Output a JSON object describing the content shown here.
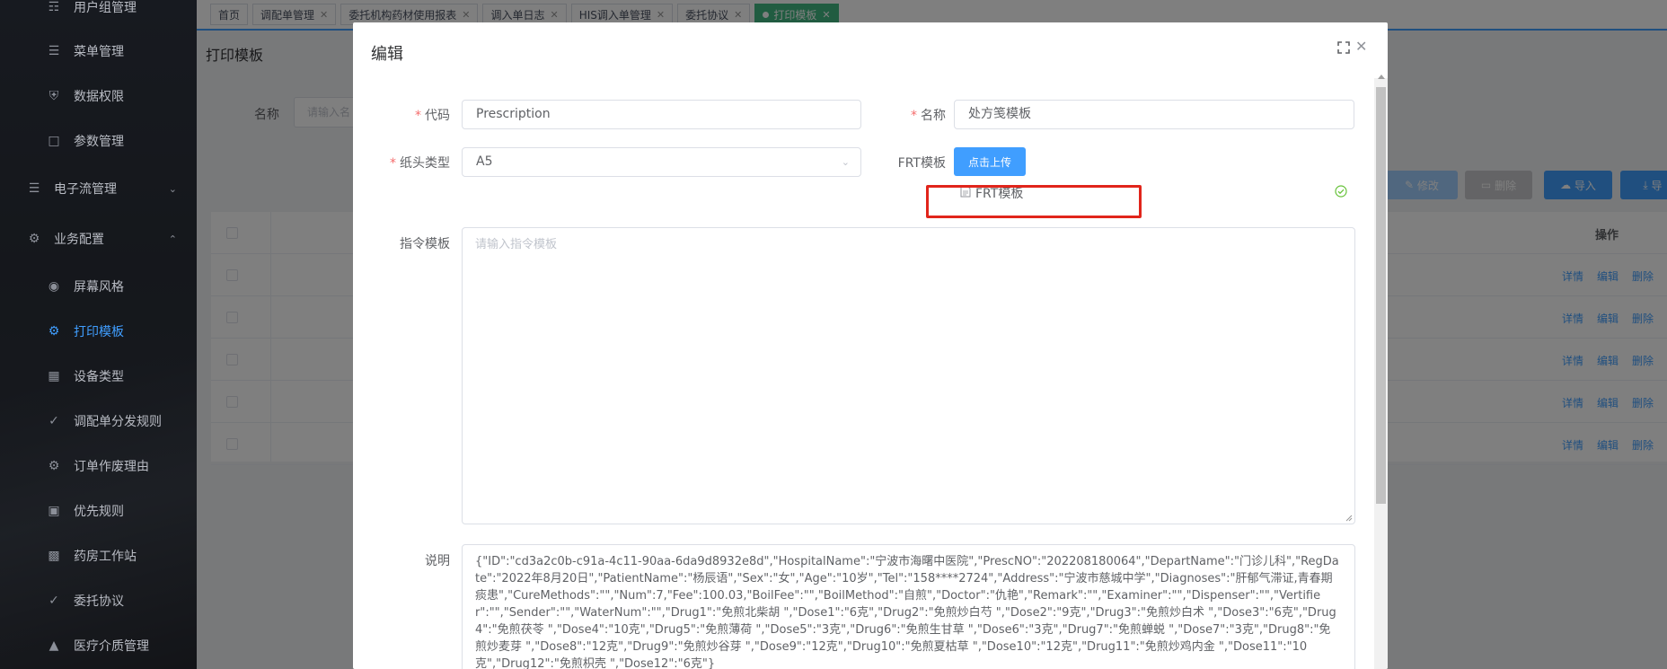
{
  "sidebar": {
    "items": [
      {
        "label": "用户组管理",
        "icon": "sitemap-icon"
      },
      {
        "label": "菜单管理",
        "icon": "menu-icon"
      },
      {
        "label": "数据权限",
        "icon": "shield-icon"
      },
      {
        "label": "参数管理",
        "icon": "document-icon"
      },
      {
        "label": "电子流管理",
        "icon": "sliders-icon"
      },
      {
        "label": "业务配置",
        "icon": "gear-icon"
      },
      {
        "label": "屏幕风格",
        "icon": "palette-icon"
      },
      {
        "label": "打印模板",
        "icon": "gear-icon"
      },
      {
        "label": "设备类型",
        "icon": "grid-icon"
      },
      {
        "label": "调配单分发规则",
        "icon": "rule-icon"
      },
      {
        "label": "订单作废理由",
        "icon": "gear-icon"
      },
      {
        "label": "优先规则",
        "icon": "robot-icon"
      },
      {
        "label": "药房工作站",
        "icon": "monitor-icon"
      },
      {
        "label": "委托协议",
        "icon": "check-circle-icon"
      },
      {
        "label": "医疗介质管理",
        "icon": "stamp-icon"
      }
    ]
  },
  "tabs": [
    {
      "label": "首页",
      "closable": false
    },
    {
      "label": "调配单管理",
      "closable": true
    },
    {
      "label": "委托机构药材使用报表",
      "closable": true
    },
    {
      "label": "调入单日志",
      "closable": true
    },
    {
      "label": "HIS调入单管理",
      "closable": true
    },
    {
      "label": "委托协议",
      "closable": true
    },
    {
      "label": "打印模板",
      "closable": true,
      "active": true
    }
  ],
  "main": {
    "title": "打印模板",
    "filter_label": "名称",
    "filter_placeholder": "请输入名",
    "buttons": {
      "edit": "修改",
      "delete": "删除",
      "import": "导入",
      "export": "导"
    },
    "table": {
      "op_header": "操作",
      "row_links": [
        "详情",
        "编辑",
        "删除"
      ]
    }
  },
  "dialog": {
    "title": "编辑",
    "fields": {
      "code_label": "代码",
      "code_value": "Prescription",
      "name_label": "名称",
      "name_value": "处方笺模板",
      "paper_label": "纸头类型",
      "paper_value": "A5",
      "frt_label": "FRT模板",
      "upload_button": "点击上传",
      "uploaded_file": "FRT模板",
      "command_label": "指令模板",
      "command_placeholder": "请输入指令模板",
      "desc_label": "说明",
      "desc_value": "{\"ID\":\"cd3a2c0b-c91a-4c11-90aa-6da9d8932e8d\",\"HospitalName\":\"宁波市海曙中医院\",\"PrescNO\":\"202208180064\",\"DepartName\":\"门诊儿科\",\"RegDate\":\"2022年8月20日\",\"PatientName\":\"杨辰语\",\"Sex\":\"女\",\"Age\":\"10岁\",\"Tel\":\"158****2724\",\"Address\":\"宁波市慈城中学\",\"Diagnoses\":\"肝郁气滞证,青春期痰患\",\"CureMethods\":\"\",\"Num\":7,\"Fee\":100.03,\"BoilFee\":\"\",\"BoilMethod\":\"自煎\",\"Doctor\":\"仇艳\",\"Remark\":\"\",\"Examiner\":\"\",\"Dispenser\":\"\",\"Vertifier\":\"\",\"Sender\":\"\",\"WaterNum\":\"\",\"Drug1\":\"免煎北柴胡 \",\"Dose1\":\"6克\",\"Drug2\":\"免煎炒白芍 \",\"Dose2\":\"9克\",\"Drug3\":\"免煎炒白术 \",\"Dose3\":\"6克\",\"Drug4\":\"免煎茯苓 \",\"Dose4\":\"10克\",\"Drug5\":\"免煎薄荷 \",\"Dose5\":\"3克\",\"Drug6\":\"免煎生甘草 \",\"Dose6\":\"3克\",\"Drug7\":\"免煎蝉蜕 \",\"Dose7\":\"3克\",\"Drug8\":\"免煎炒麦芽 \",\"Dose8\":\"12克\",\"Drug9\":\"免煎炒谷芽 \",\"Dose9\":\"12克\",\"Drug10\":\"免煎夏枯草 \",\"Dose10\":\"12克\",\"Drug11\":\"免煎炒鸡内金 \",\"Dose11\":\"10克\",\"Drug12\":\"免煎枳壳 \",\"Dose12\":\"6克\"}"
    }
  },
  "colors": {
    "primary": "#409eff",
    "active_tab": "#42b983",
    "required": "#f56c6c",
    "highlight": "#e1251b",
    "success": "#67c23a"
  }
}
